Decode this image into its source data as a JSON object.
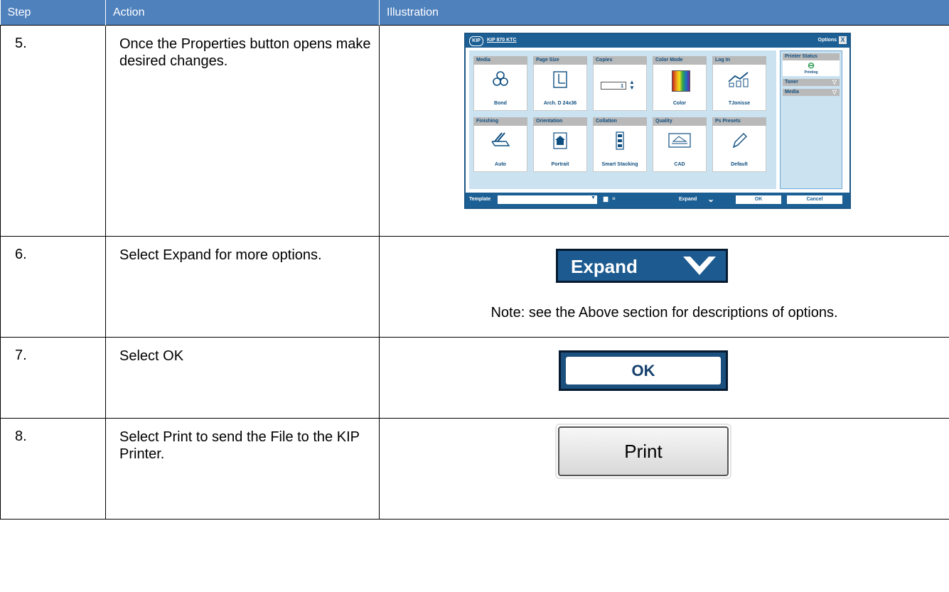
{
  "header": {
    "step": "Step",
    "action": "Action",
    "illustration": "Illustration"
  },
  "rows": [
    {
      "step": "5.",
      "action": "Once the Properties button opens make desired changes."
    },
    {
      "step": "6.",
      "action": "Select Expand for more options."
    },
    {
      "step": "7.",
      "action": "Select OK"
    },
    {
      "step": "8.",
      "action": "Select Print to send the File to the KIP Printer."
    }
  ],
  "dialog": {
    "logo": "KIP",
    "printer": "KIP 870 KTC",
    "options": "Options",
    "close": "X",
    "tiles": [
      {
        "header": "Media",
        "label": "Bond",
        "icon": "media-icon"
      },
      {
        "header": "Page Size",
        "label": "Arch. D 24x36",
        "icon": "page-size-icon"
      },
      {
        "header": "Copies",
        "value": "1",
        "icon": "copies-stepper"
      },
      {
        "header": "Color Mode",
        "label": "Color",
        "icon": "color-mode-icon"
      },
      {
        "header": "Log In",
        "label": "TJonisse",
        "icon": "login-chart-icon"
      },
      {
        "header": "Finishing",
        "label": "Auto",
        "icon": "finishing-icon"
      },
      {
        "header": "Orientation",
        "label": "Portrait",
        "icon": "house-icon"
      },
      {
        "header": "Collation",
        "label": "Smart Stacking",
        "icon": "collation-icon"
      },
      {
        "header": "Quality",
        "label": "CAD",
        "icon": "quality-icon"
      },
      {
        "header": "Ps Presets",
        "label": "Default",
        "icon": "pencil-icon"
      }
    ],
    "status": {
      "title": "Printer Status",
      "state": "Printing",
      "toner": "Toner",
      "media": "Media"
    },
    "footer": {
      "template": "Template",
      "expand": "Expand",
      "ok": "OK",
      "cancel": "Cancel"
    }
  },
  "expand_button": {
    "label": "Expand"
  },
  "note": "Note: see the Above section for descriptions of options.",
  "ok_button": {
    "label": "OK"
  },
  "print_button": {
    "label": "Print"
  },
  "colors": {
    "header_bg": "#4f81bd",
    "kip_blue": "#1c5f94"
  }
}
